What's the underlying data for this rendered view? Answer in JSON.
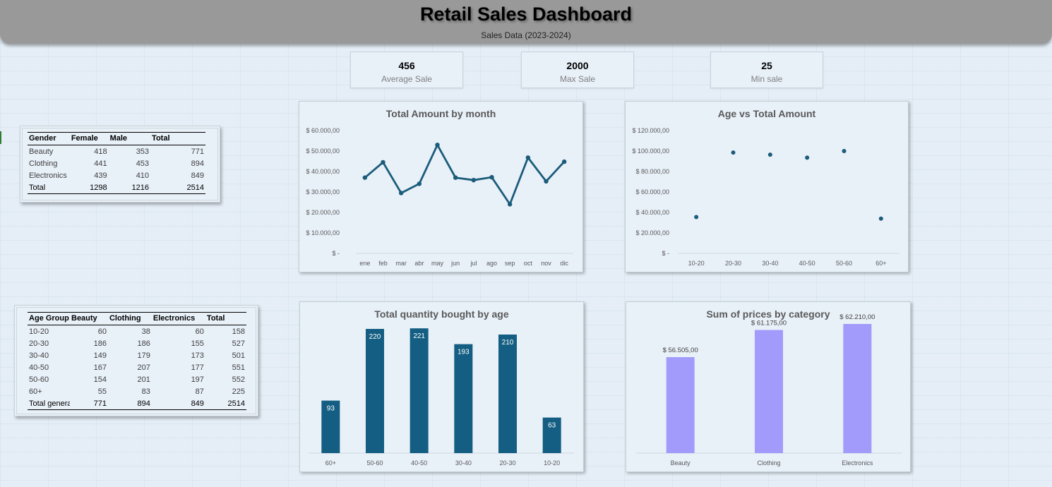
{
  "header": {
    "title": "Retail Sales Dashboard",
    "subtitle": "Sales Data (2023-2024)"
  },
  "kpis": [
    {
      "value": "456",
      "label": "Average Sale"
    },
    {
      "value": "2000",
      "label": "Max Sale"
    },
    {
      "value": "25",
      "label": "Min sale"
    }
  ],
  "gender_table": {
    "headers": [
      "Gender",
      "Female",
      "Male",
      "Total"
    ],
    "rows": [
      [
        "Beauty",
        "418",
        "353",
        "771"
      ],
      [
        "Clothing",
        "441",
        "453",
        "894"
      ],
      [
        "Electronics",
        "439",
        "410",
        "849"
      ]
    ],
    "total": [
      "Total",
      "1298",
      "1216",
      "2514"
    ]
  },
  "age_table": {
    "headers": [
      "Age Group",
      "Beauty",
      "Clothing",
      "Electronics",
      "Total"
    ],
    "rows": [
      [
        "10-20",
        "60",
        "38",
        "60",
        "158"
      ],
      [
        "20-30",
        "186",
        "186",
        "155",
        "527"
      ],
      [
        "30-40",
        "149",
        "179",
        "173",
        "501"
      ],
      [
        "40-50",
        "167",
        "207",
        "177",
        "551"
      ],
      [
        "50-60",
        "154",
        "201",
        "197",
        "552"
      ],
      [
        "60+",
        "55",
        "83",
        "87",
        "225"
      ]
    ],
    "total": [
      "Total general",
      "771",
      "894",
      "849",
      "2514"
    ]
  },
  "colors": {
    "line": "#1a5c7a",
    "bar": "#135e82",
    "bar2": "#a29bfb"
  },
  "chart_data": [
    {
      "type": "line",
      "title": "Total Amount by month",
      "categories": [
        "ene",
        "feb",
        "mar",
        "abr",
        "may",
        "jun",
        "jul",
        "ago",
        "sep",
        "oct",
        "nov",
        "dic"
      ],
      "values": [
        37000,
        44500,
        29500,
        34000,
        53000,
        37000,
        35800,
        37200,
        24000,
        46800,
        35200,
        44800
      ],
      "ylim": [
        0,
        60000
      ],
      "yticks": [
        0,
        10000,
        20000,
        30000,
        40000,
        50000,
        60000
      ],
      "ytick_labels": [
        "$ -",
        "$ 10.000,00",
        "$ 20.000,00",
        "$ 30.000,00",
        "$ 40.000,00",
        "$ 50.000,00",
        "$ 60.000,00"
      ],
      "grid": false
    },
    {
      "type": "scatter",
      "title": "Age  vs Total Amount",
      "categories": [
        "10-20",
        "20-30",
        "30-40",
        "40-50",
        "50-60",
        "60+"
      ],
      "values": [
        35500,
        98500,
        96500,
        93500,
        100000,
        34000
      ],
      "ylim": [
        0,
        120000
      ],
      "yticks": [
        0,
        20000,
        40000,
        60000,
        80000,
        100000,
        120000
      ],
      "ytick_labels": [
        "$ -",
        "$ 20.000,00",
        "$ 40.000,00",
        "$ 60.000,00",
        "$ 80.000,00",
        "$ 100.000,00",
        "$ 120.000,00"
      ],
      "grid": false
    },
    {
      "type": "bar",
      "title": "Total quantity bought by age",
      "categories": [
        "60+",
        "50-60",
        "40-50",
        "30-40",
        "20-30",
        "10-20"
      ],
      "values": [
        93,
        220,
        221,
        193,
        210,
        63
      ],
      "data_labels": [
        "93",
        "220",
        "221",
        "193",
        "210",
        "63"
      ],
      "ylim": [
        0,
        250
      ]
    },
    {
      "type": "bar",
      "title": "Sum of prices by category",
      "categories": [
        "Beauty",
        "Clothing",
        "Electronics"
      ],
      "values": [
        56505,
        61175,
        62210
      ],
      "data_labels": [
        "$ 56.505,00",
        "$ 61.175,00",
        "$ 62.210,00"
      ],
      "ylim": [
        40000,
        65000
      ]
    }
  ]
}
